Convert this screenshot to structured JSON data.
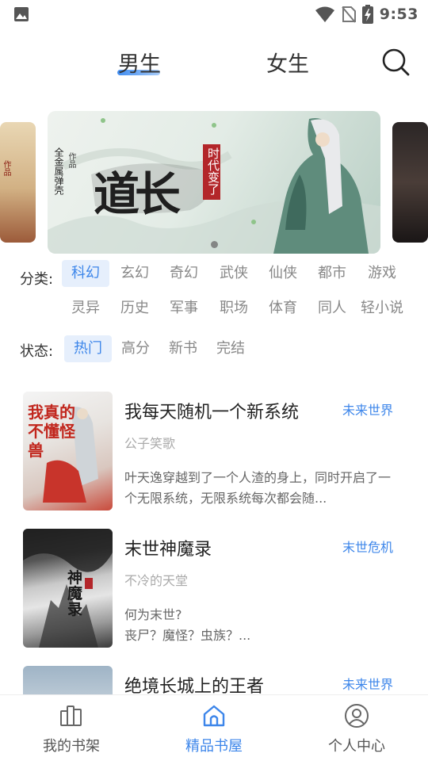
{
  "status_bar": {
    "time": "9:53",
    "icons": [
      "image-icon",
      "wifi-icon",
      "no-sim-icon",
      "battery-charging-icon"
    ]
  },
  "header": {
    "tabs": [
      {
        "label": "男生",
        "active": true
      },
      {
        "label": "女生",
        "active": false
      }
    ],
    "search_icon": "search-icon"
  },
  "banner": {
    "left_card_text": "作品",
    "title": "道长",
    "stamp": "时代变了",
    "small_label": "作品",
    "author": "全金属弹壳",
    "slide_count": 1
  },
  "category": {
    "label": "分类:",
    "options": [
      "科幻",
      "玄幻",
      "奇幻",
      "武侠",
      "仙侠",
      "都市",
      "游戏",
      "灵异",
      "历史",
      "军事",
      "职场",
      "体育",
      "同人",
      "轻小说"
    ],
    "selected": "科幻"
  },
  "status_filter": {
    "label": "状态:",
    "options": [
      "热门",
      "高分",
      "新书",
      "完结"
    ],
    "selected": "热门"
  },
  "books": [
    {
      "title": "我每天随机一个新系统",
      "tag": "未来世界",
      "author": "公子笑歌",
      "description": "叶天逸穿越到了一个人渣的身上，同时开启了一个无限系统，无限系统每次都会随...",
      "cover_text": "我真的不懂怪兽"
    },
    {
      "title": "末世神魔录",
      "tag": "末世危机",
      "author": "不冷的天堂",
      "description": "何为末世?\n      丧尸？魔怪？虫族？...",
      "cover_text": "神魔录"
    },
    {
      "title": "绝境长城上的王者",
      "tag": "未来世界",
      "author": "",
      "description": ""
    }
  ],
  "bottom_nav": [
    {
      "label": "我的书架",
      "icon": "bookshelf-icon",
      "active": false
    },
    {
      "label": "精品书屋",
      "icon": "bookstore-icon",
      "active": true
    },
    {
      "label": "个人中心",
      "icon": "profile-icon",
      "active": false
    }
  ],
  "colors": {
    "accent": "#3d86ea",
    "chip_active_bg": "#e6effc",
    "muted_text": "#888888"
  }
}
